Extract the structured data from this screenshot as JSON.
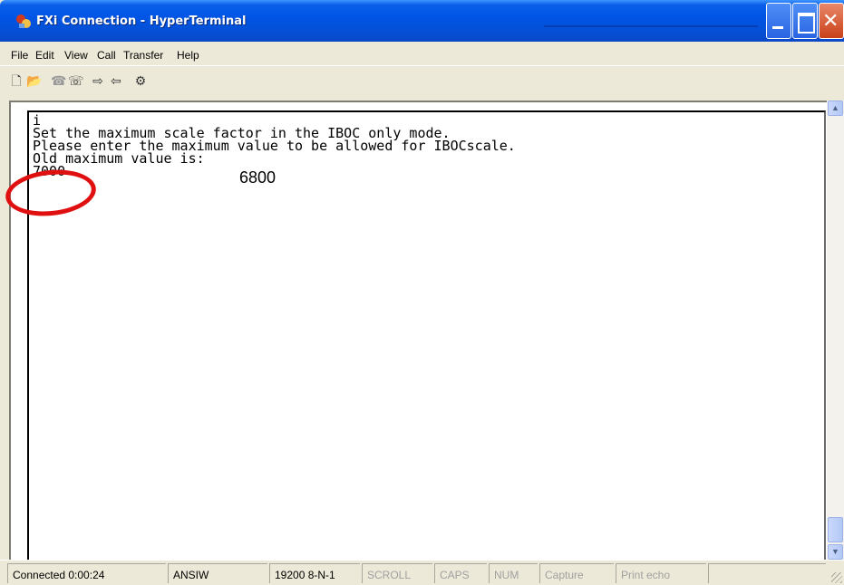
{
  "window": {
    "title": "FXi Connection - HyperTerminal"
  },
  "menu": [
    "File",
    "Edit",
    "View",
    "Call",
    "Transfer",
    "Help"
  ],
  "toolbar": {
    "icons": [
      "new-icon",
      "open-icon",
      "connect-icon",
      "disconnect-icon",
      "send-icon",
      "receive-icon",
      "properties-icon"
    ]
  },
  "terminal": {
    "lines": [
      "i",
      "Set the maximum scale factor in the IBOC only mode.",
      "Please enter the maximum value to be allowed for IBOCscale.",
      "Old maximum value is:",
      "7000"
    ],
    "overlay_value": "6800",
    "highlight_color": "#e01010"
  },
  "status": {
    "connection": "Connected 0:00:24",
    "emulation": "ANSIW",
    "settings": "19200 8-N-1",
    "scroll": "SCROLL",
    "caps": "CAPS",
    "num": "NUM",
    "capture": "Capture",
    "print_echo": "Print echo"
  },
  "colors": {
    "titlebar": "#0055e5",
    "chrome": "#ece9d8",
    "close": "#c94118"
  }
}
